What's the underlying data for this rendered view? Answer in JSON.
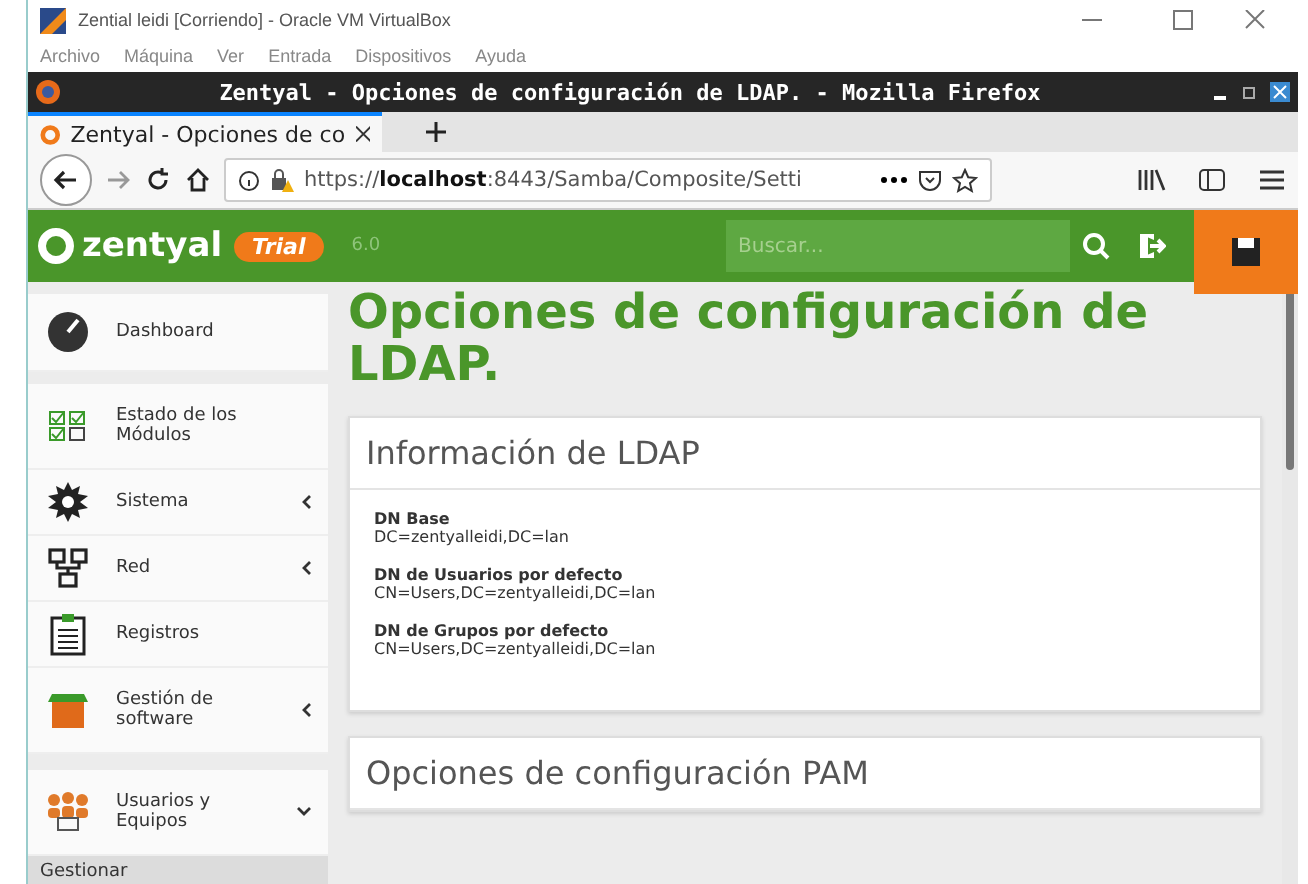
{
  "vbox": {
    "title": "Zential leidi [Corriendo] - Oracle VM VirtualBox",
    "menu": [
      "Archivo",
      "Máquina",
      "Ver",
      "Entrada",
      "Dispositivos",
      "Ayuda"
    ]
  },
  "browser": {
    "title": "Zentyal - Opciones de configuración de LDAP. - Mozilla Firefox",
    "tabs": [
      {
        "title": "Zentyal - Opciones de co",
        "selected": true
      }
    ],
    "url": "https://**localhost**:8443/Samba/Composite/Setti"
  },
  "header": {
    "logo": "zentyal",
    "badge": "Trial",
    "version": "6.0",
    "search": {
      "placeholder": "Buscar..."
    }
  },
  "sidebar": {
    "items": [
      {
        "label": "Dashboard",
        "kind": "link"
      },
      {
        "label": "Estado de los Módulos",
        "kind": "link"
      },
      {
        "label": "Sistema",
        "kind": "submenu",
        "expanded": false
      },
      {
        "label": "Red",
        "kind": "submenu",
        "expanded": false
      },
      {
        "label": "Registros",
        "kind": "link"
      },
      {
        "label": "Gestión de software",
        "kind": "submenu",
        "expanded": false
      },
      {
        "label": "Usuarios y Equipos",
        "kind": "submenu",
        "expanded": true,
        "children": [
          {
            "label": "Gestionar"
          }
        ]
      }
    ]
  },
  "main": {
    "title": "Opciones de configuración de LDAP.",
    "sections": [
      {
        "title": "Información de LDAP",
        "fields": [
          {
            "label": "DN Base",
            "value": "DC=zentyalleidi,DC=lan"
          },
          {
            "label": "DN de Usuarios por defecto",
            "value": "CN=Users,DC=zentyalleidi,DC=lan"
          },
          {
            "label": "DN de Grupos por defecto",
            "value": "CN=Users,DC=zentyalleidi,DC=lan"
          }
        ]
      },
      {
        "title": "Opciones de configuración PAM"
      }
    ]
  }
}
